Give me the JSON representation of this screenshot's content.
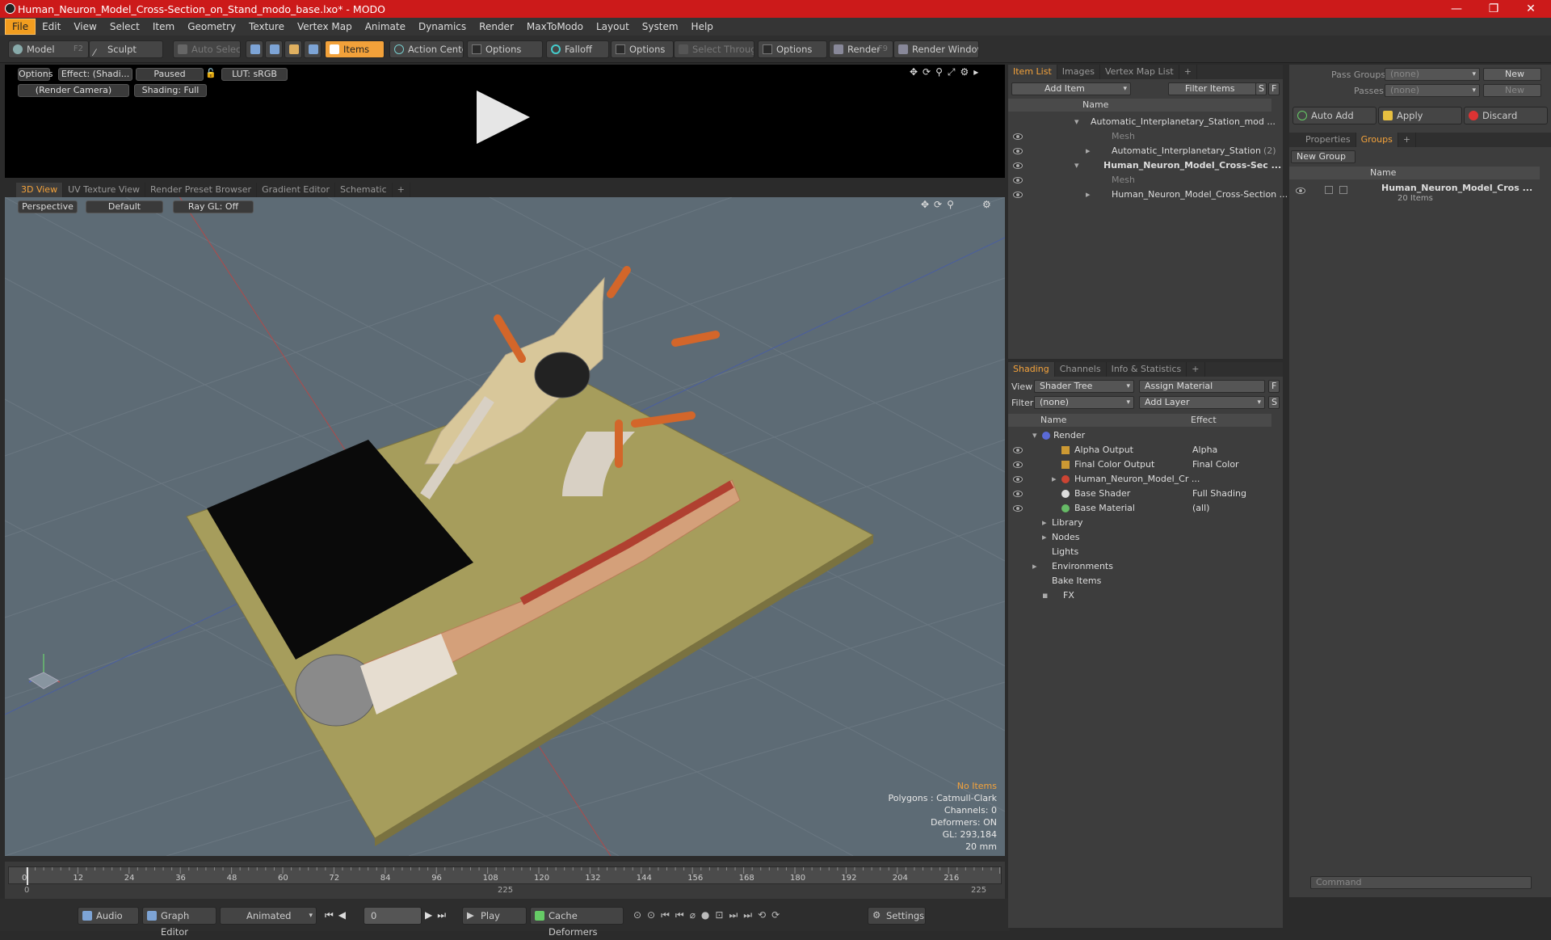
{
  "window": {
    "title": "Human_Neuron_Model_Cross-Section_on_Stand_modo_base.lxo* - MODO"
  },
  "menu": [
    "File",
    "Edit",
    "View",
    "Select",
    "Item",
    "Geometry",
    "Texture",
    "Vertex Map",
    "Animate",
    "Dynamics",
    "Render",
    "MaxToModo",
    "Layout",
    "System",
    "Help"
  ],
  "toolbar": {
    "model": "Model",
    "model_key": "F2",
    "sculpt": "Sculpt",
    "auto_select": "Auto Select",
    "items": "Items",
    "action_center": "Action Center",
    "options1": "Options",
    "falloff": "Falloff",
    "options2": "Options",
    "select_through": "Select Through",
    "options3": "Options",
    "render": "Render",
    "render_key": "F9",
    "render_window": "Render Window"
  },
  "preview": {
    "options": "Options",
    "effect": "Effect: (Shadi...",
    "paused": "Paused",
    "lut": "LUT: sRGB",
    "camera": "(Render Camera)",
    "shading": "Shading: Full"
  },
  "viewtabs": [
    "3D View",
    "UV Texture View",
    "Render Preset Browser",
    "Gradient Editor",
    "Schematic",
    "+"
  ],
  "viewport": {
    "perspective": "Perspective",
    "default": "Default",
    "raygl": "Ray GL: Off",
    "info_noitems": "No Items",
    "info_polygons": "Polygons : Catmull-Clark",
    "info_channels": "Channels: 0",
    "info_deformers": "Deformers: ON",
    "info_gl": "GL: 293,184",
    "info_size": "20 mm"
  },
  "timeline": {
    "ticks": [
      "0",
      "12",
      "24",
      "36",
      "48",
      "60",
      "72",
      "84",
      "96",
      "108",
      "120",
      "132",
      "144",
      "156",
      "168",
      "180",
      "192",
      "204",
      "216"
    ],
    "start": "0",
    "mid": "225",
    "end": "225"
  },
  "bottombar": {
    "audio": "Audio",
    "graph_editor": "Graph Editor",
    "animated": "Animated",
    "frame": "0",
    "play": "Play",
    "cache": "Cache Deformers",
    "settings": "Settings"
  },
  "itemlist": {
    "tabs": [
      "Item List",
      "Images",
      "Vertex Map List",
      "+"
    ],
    "add_item": "Add Item",
    "filter_items": "Filter Items",
    "s": "S",
    "f": "F",
    "col_name": "Name",
    "rows": [
      {
        "label": "Automatic_Interplanetary_Station_mod ..."
      },
      {
        "label": "Mesh"
      },
      {
        "label": "Automatic_Interplanetary_Station",
        "suffix": "(2)"
      },
      {
        "label": "Human_Neuron_Model_Cross-Sec ..."
      },
      {
        "label": "Mesh"
      },
      {
        "label": "Human_Neuron_Model_Cross-Section ..."
      }
    ]
  },
  "shading": {
    "tabs": [
      "Shading",
      "Channels",
      "Info & Statistics",
      "+"
    ],
    "view_label": "View",
    "view_value": "Shader Tree",
    "assign": "Assign Material",
    "f": "F",
    "filter_label": "Filter",
    "filter_value": "(none)",
    "add_layer": "Add Layer",
    "s": "S",
    "col_name": "Name",
    "col_effect": "Effect",
    "rows": [
      {
        "label": "Render",
        "effect": ""
      },
      {
        "label": "Alpha Output",
        "effect": "Alpha"
      },
      {
        "label": "Final Color Output",
        "effect": "Final Color"
      },
      {
        "label": "Human_Neuron_Model_Cr ...",
        "effect": ""
      },
      {
        "label": "Base Shader",
        "effect": "Full Shading"
      },
      {
        "label": "Base Material",
        "effect": "(all)"
      },
      {
        "label": "Library",
        "effect": ""
      },
      {
        "label": "Nodes",
        "effect": ""
      },
      {
        "label": "Lights",
        "effect": ""
      },
      {
        "label": "Environments",
        "effect": ""
      },
      {
        "label": "Bake Items",
        "effect": ""
      },
      {
        "label": "FX",
        "effect": ""
      }
    ]
  },
  "groups": {
    "pass_groups": "Pass Groups",
    "pass_value": "(none)",
    "new": "New",
    "passes": "Passes",
    "passes_value": "(none)",
    "new2": "New",
    "auto_add": "Auto Add",
    "apply": "Apply",
    "discard": "Discard",
    "tabs": [
      "Properties",
      "Groups",
      "+"
    ],
    "new_group": "New Group",
    "col_name": "Name",
    "group_name": "Human_Neuron_Model_Cros ...",
    "group_count": "20 Items"
  },
  "command": {
    "placeholder": "Command"
  }
}
